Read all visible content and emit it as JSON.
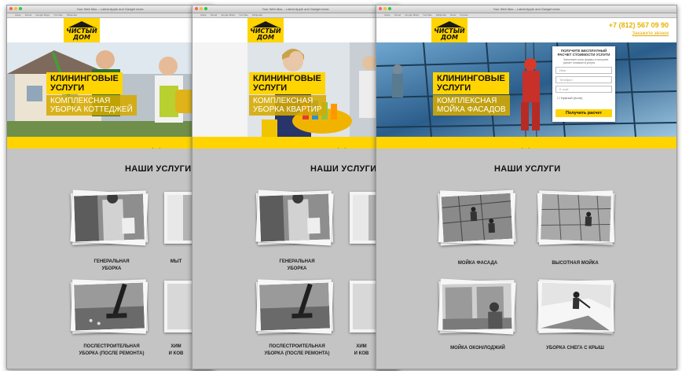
{
  "browser": {
    "title_1": "Your Web Mac – Latest Apple and Gadget news",
    "title_2": "Your Web Mac – Latest Apple and Gadget news",
    "title_3": "Your Web Mac – Latest Apple and Gadget news",
    "bookmarks": [
      "Apple",
      "iCloud",
      "Google Maps",
      "YouTube",
      "Wikipedia",
      "News",
      "Popular"
    ]
  },
  "brand": {
    "logo_line1": "ЧИСТЫЙ",
    "logo_line2": "ДОМ",
    "accent": "#ffd400"
  },
  "contact": {
    "phone": "+7 (812) 567 09 90",
    "callback": "Закажите звонок"
  },
  "heroes": [
    {
      "title_1": "КЛИНИНГОВЫЕ",
      "title_2": "УСЛУГИ",
      "sub_1": "КОМПЛЕКСНАЯ",
      "sub_2": "УБОРКА КОТТЕДЖЕЙ"
    },
    {
      "title_1": "КЛИНИНГОВЫЕ",
      "title_2": "УСЛУГИ",
      "sub_1": "КОМПЛЕКСНАЯ",
      "sub_2": "УБОРКА КВАРТИР"
    },
    {
      "title_1": "КЛИНИНГОВЫЕ",
      "title_2": "УСЛУГИ",
      "sub_1": "КОМПЛЕКСНАЯ",
      "sub_2": "МОЙКА ФАСАДОВ"
    }
  ],
  "form": {
    "heading_1": "ПОЛУЧИТЕ БЕСПЛАТНЫЙ",
    "heading_2": "РАСЧЕТ СТОИМОСТИ УСЛУГИ",
    "note": "Заполните поля формы и получите расчет стоимости услуги",
    "field_name": "Имя",
    "field_phone": "Телефон",
    "field_email": "E-mail",
    "checkbox_label": "Нужный (поле)",
    "submit_label": "Получить расчет"
  },
  "services": {
    "title": "НАШИ УСЛУГИ",
    "left_1": "ГЕНЕРАЛЬНАЯ",
    "left_2": "УБОРКА",
    "left_3": "ПОСЛЕСТРОИТЕЛЬНАЯ",
    "left_4": "УБОРКА (ПОСЛЕ РЕМОНТА)",
    "cut_1": "МЫТ",
    "cut_2": "ХИМ",
    "cut_3": "И КОВ",
    "right_1": "МОЙКА ФАСАДА",
    "right_2": "ВЫСОТНАЯ МОЙКА",
    "right_3": "МОЙКА ОКОН/ЛОДЖИЙ",
    "right_4": "УБОРКА СНЕГА С КРЫШ"
  }
}
